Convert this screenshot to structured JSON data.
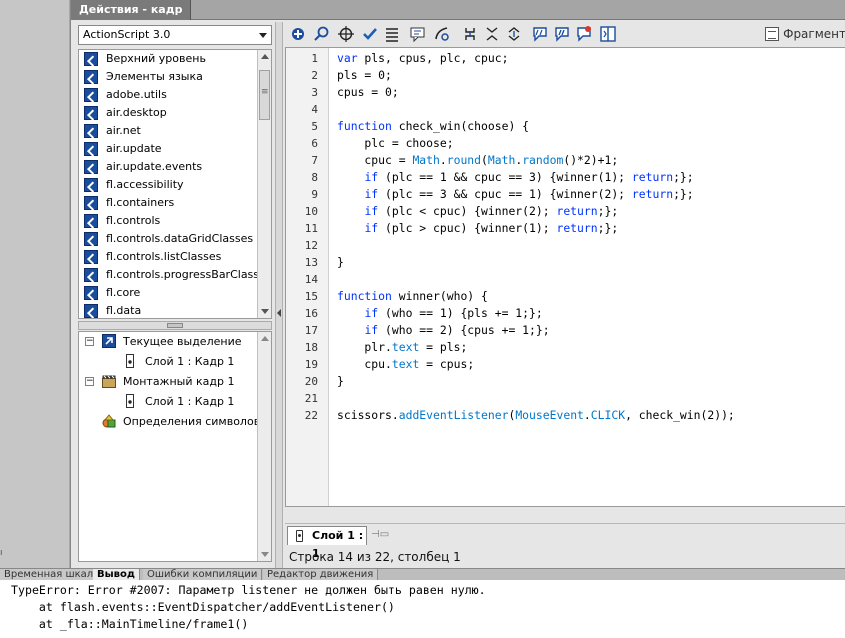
{
  "panel": {
    "title": "Действия - кадр"
  },
  "language": {
    "selected": "ActionScript 3.0"
  },
  "packages": [
    "Верхний уровень",
    "Элементы языка",
    "adobe.utils",
    "air.desktop",
    "air.net",
    "air.update",
    "air.update.events",
    "fl.accessibility",
    "fl.containers",
    "fl.controls",
    "fl.controls.dataGridClasses",
    "fl.controls.listClasses",
    "fl.controls.progressBarClasses",
    "fl.core",
    "fl.data"
  ],
  "script_nav": {
    "current_selection": "Текущее выделение",
    "current_selection_item": "Слой 1 : Кадр 1",
    "scene_frame": "Монтажный кадр 1",
    "scene_frame_item": "Слой 1 : Кадр 1",
    "symbol_definitions": "Определения символов"
  },
  "toolbar": {
    "snippets_label": "Фрагмент"
  },
  "code_lines": [
    "var pls, cpus, plc, cpuc;",
    "pls = 0;",
    "cpus = 0;",
    "",
    "function check_win(choose) {",
    "    plc = choose;",
    "    cpuc = Math.round(Math.random()*2)+1;",
    "    if (plc == 1 && cpuc == 3) {winner(1); return;};",
    "    if (plc == 3 && cpuc == 1) {winner(2); return;};",
    "    if (plc < cpuc) {winner(2); return;};",
    "    if (plc > cpuc) {winner(1); return;};",
    "",
    "}",
    "",
    "function winner(who) {",
    "    if (who == 1) {pls += 1;};",
    "    if (who == 2) {cpus += 1;};",
    "    plr.text = pls;",
    "    cpu.text = cpus;",
    "}",
    "",
    "scissors.addEventListener(MouseEvent.CLICK, check_win(2));"
  ],
  "editor_tab": {
    "label": "Слой 1 : 1"
  },
  "status": {
    "cursor": "Строка 14 из 22, столбец 1"
  },
  "output_tabs": [
    "Временная шкала",
    "Вывод",
    "Ошибки компиляции",
    "Редактор движения"
  ],
  "output_lines": [
    "TypeError: Error #2007: Параметр listener не должен быть равен нулю.",
    "    at flash.events::EventDispatcher/addEventListener()",
    "    at _fla::MainTimeline/frame1()"
  ],
  "colors": {
    "keyword": "#0033ff",
    "builtin": "#0077cc",
    "package_icon": "#1a4d9c"
  }
}
